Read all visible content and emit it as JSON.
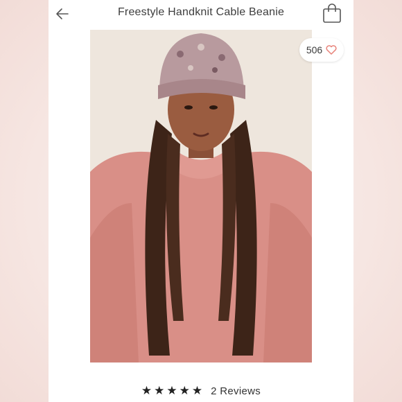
{
  "header": {
    "title": "Freestyle Handknit Cable Beanie",
    "back_icon": "arrow-left-icon",
    "bag_icon": "shopping-bag-icon"
  },
  "photo": {
    "description_icon": "product-photo"
  },
  "likes": {
    "count": "506",
    "icon": "heart-outline-icon",
    "icon_color": "#e8837a"
  },
  "rating": {
    "stars": 5,
    "max_stars": 5,
    "reviews_label": "2 Reviews"
  },
  "colors": {
    "background": "#f6e6e2",
    "panel": "#ffffff",
    "text": "#3a3a3a",
    "accent": "#e8837a"
  }
}
